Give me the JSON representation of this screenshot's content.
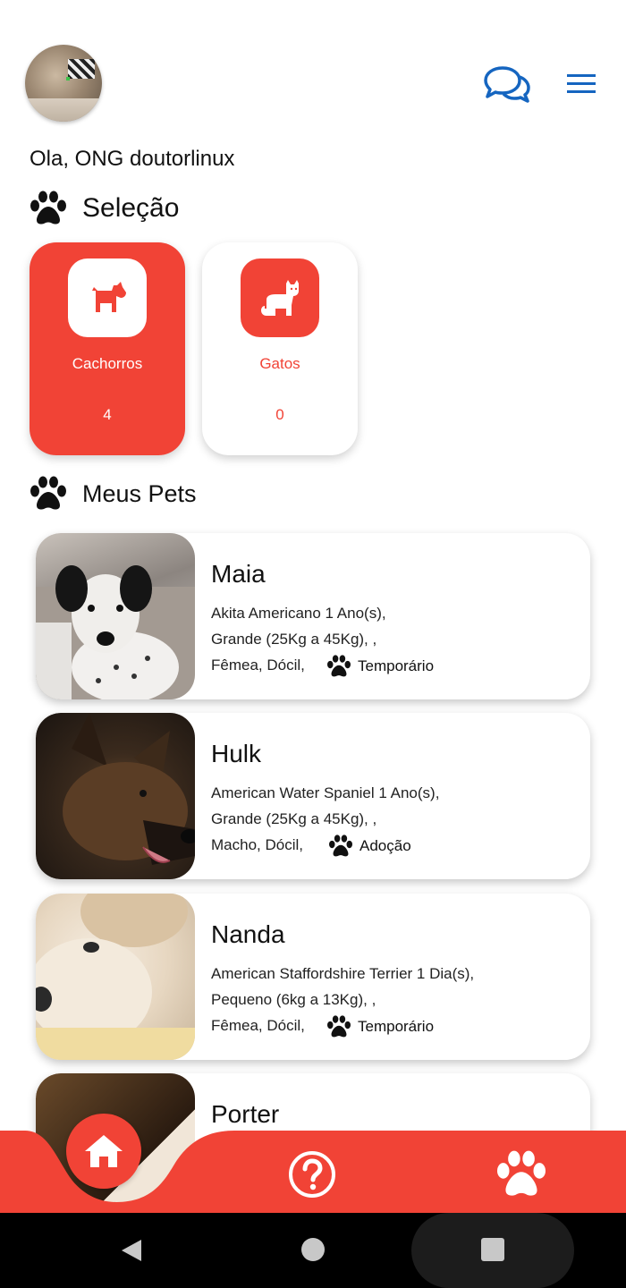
{
  "header": {
    "chat_icon": "chat-bubbles-icon",
    "menu_icon": "hamburger-menu-icon"
  },
  "greeting": "Ola,  ONG doutorlinux",
  "selection": {
    "title": "Seleção",
    "categories": [
      {
        "label": "Cachorros",
        "count": "4",
        "icon": "dog-icon",
        "active": true
      },
      {
        "label": "Gatos",
        "count": "0",
        "icon": "cat-icon",
        "active": false
      }
    ]
  },
  "my_pets": {
    "title": "Meus Pets",
    "pets": [
      {
        "name": "Maia",
        "line1": "Akita Americano 1 Ano(s),",
        "line2": "Grande (25Kg a 45Kg), ,",
        "line3": "Fêmea, Dócil,",
        "status": "Temporário"
      },
      {
        "name": "Hulk",
        "line1": "American Water Spaniel 1 Ano(s),",
        "line2": "Grande (25Kg a 45Kg), ,",
        "line3": "Macho, Dócil,",
        "status": "Adoção"
      },
      {
        "name": "Nanda",
        "line1": "American Staffordshire Terrier 1 Dia(s),",
        "line2": "Pequeno (6kg a 13Kg), ,",
        "line3": "Fêmea, Dócil,",
        "status": "Temporário"
      },
      {
        "name": "Porter",
        "line1": "",
        "line2": "",
        "line3": "",
        "status": ""
      }
    ]
  },
  "colors": {
    "accent": "#f14336",
    "link_blue": "#1565c0"
  },
  "bottom_nav": {
    "items": [
      "home-icon",
      "help-icon",
      "paw-icon"
    ]
  }
}
